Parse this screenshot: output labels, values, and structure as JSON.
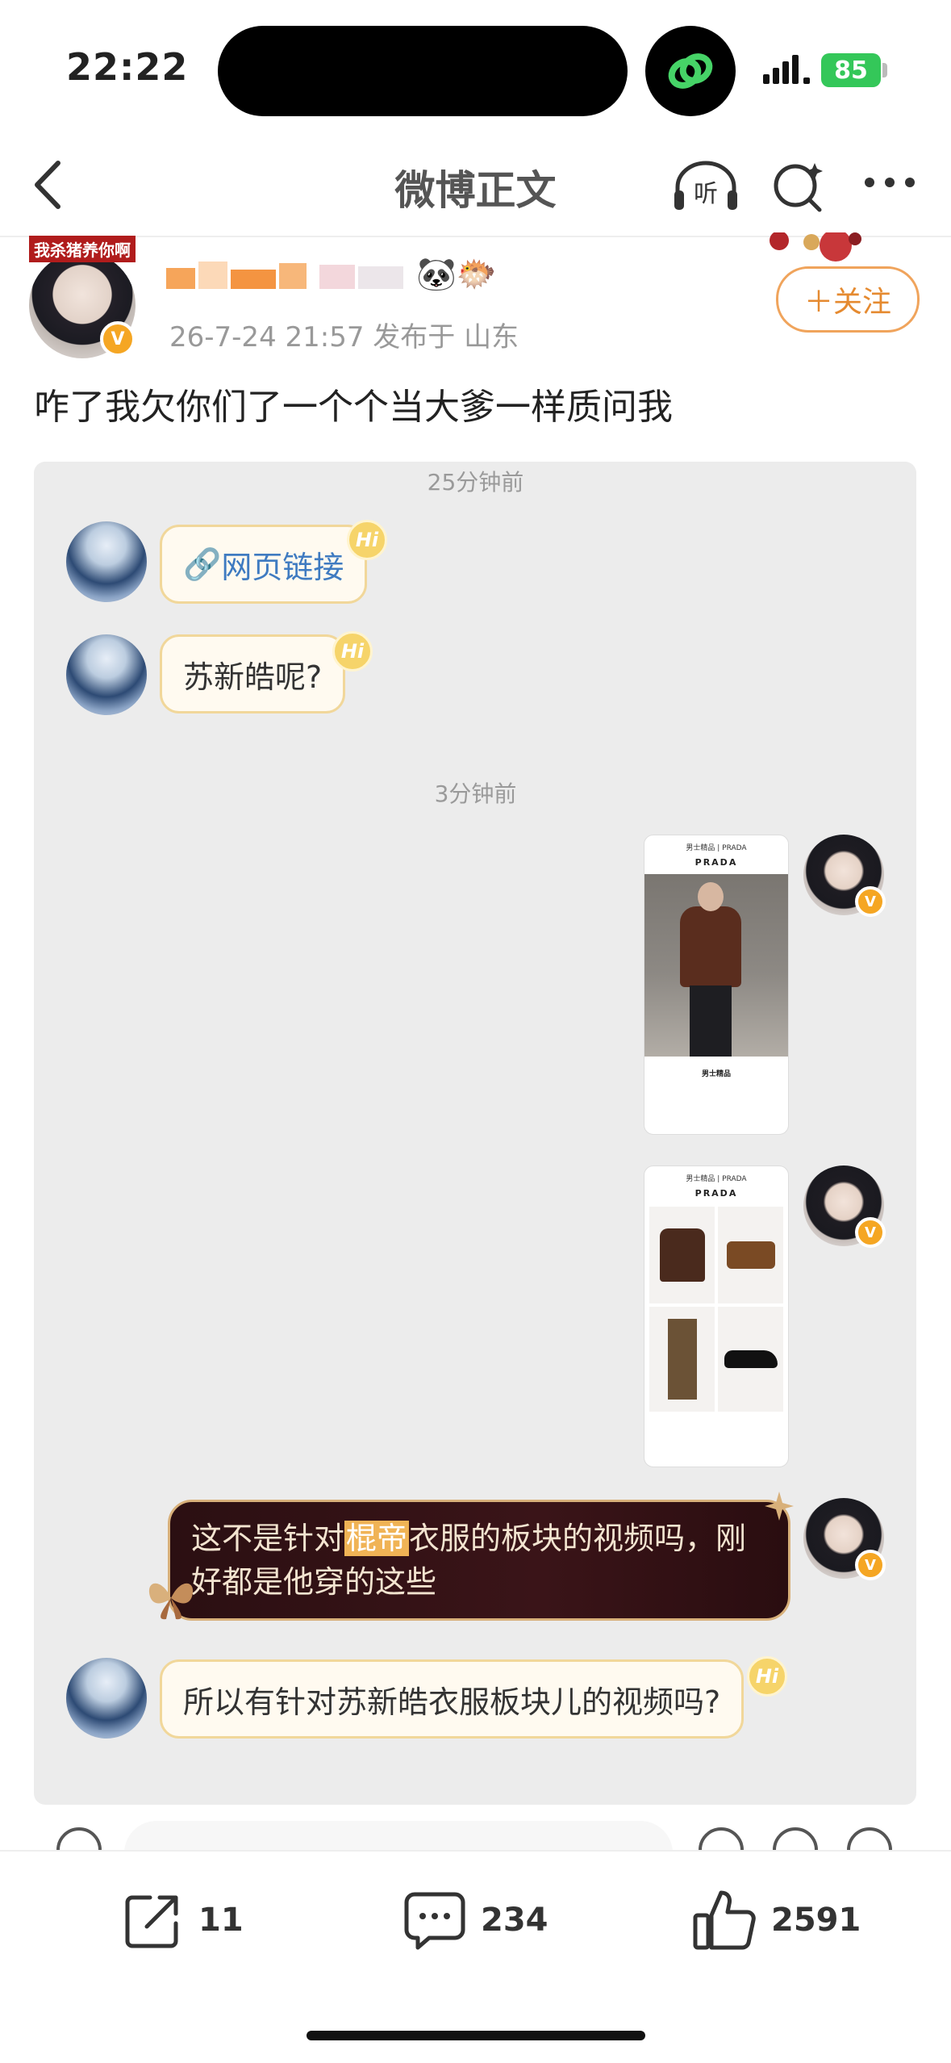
{
  "status_bar": {
    "time": "22:22",
    "battery": "85"
  },
  "nav": {
    "title": "微博正文",
    "listen_label": "听"
  },
  "author": {
    "tag": "我杀猪养你啊",
    "emoji": "🐼🐡",
    "meta": "26-7-24 21:57  发布于 山东",
    "follow_label": "＋关注"
  },
  "post": {
    "text": "咋了我欠你们了一个个当大爹一样质问我"
  },
  "chat": {
    "timestamp_1": "25分钟前",
    "msg_1_link": "网页链接",
    "msg_2": "苏新皓呢?",
    "timestamp_2": "3分钟前",
    "shot_1": {
      "header": "男士精品 | PRADA",
      "brand": "PRADA",
      "caption": "男士精品"
    },
    "shot_2": {
      "header": "男士精品 | PRADA",
      "brand": "PRADA"
    },
    "msg_3_pre": "这不是针对",
    "msg_3_highlight": "棍帝",
    "msg_3_post": "衣服的板块的视频吗，刚好都是他穿的这些",
    "msg_4": "所以有针对苏新皓衣服板块儿的视频吗?",
    "hi_label": "Hi"
  },
  "actions": {
    "repost": "11",
    "comments": "234",
    "likes": "2591"
  },
  "colors": {
    "accent": "#e58a30",
    "verified": "#f5a623",
    "link": "#3f7bc1"
  }
}
